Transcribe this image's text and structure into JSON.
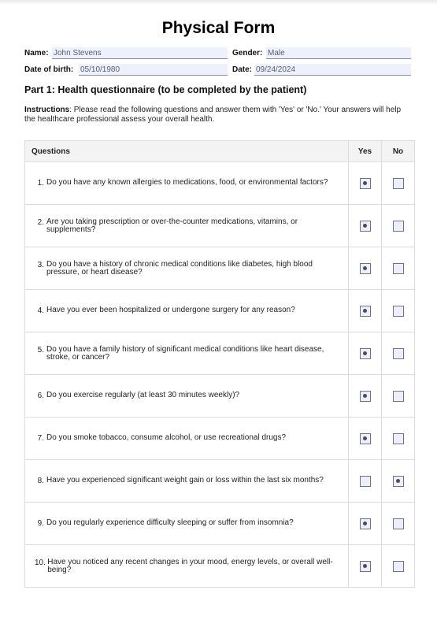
{
  "title": "Physical Form",
  "fields": {
    "name": {
      "label": "Name:",
      "value": "John Stevens"
    },
    "gender": {
      "label": "Gender:",
      "value": "Male"
    },
    "dob": {
      "label": "Date of birth:",
      "value": "05/10/1980"
    },
    "date": {
      "label": "Date:",
      "value": "09/24/2024"
    }
  },
  "part_title": "Part 1: Health questionnaire (to be completed by the patient)",
  "instructions": {
    "label": "Instructions",
    "text": ": Please read the following questions and answer them with 'Yes' or 'No.' Your answers will help the healthcare professional assess your overall health."
  },
  "table": {
    "headers": {
      "questions": "Questions",
      "yes": "Yes",
      "no": "No"
    },
    "rows": [
      {
        "num": "1.",
        "text": "Do you have any known allergies to medications, food, or environmental factors?",
        "answer": "yes"
      },
      {
        "num": "2.",
        "text": "Are you taking prescription or over-the-counter medications, vitamins, or supplements?",
        "answer": "yes"
      },
      {
        "num": "3.",
        "text": "Do you have a history of chronic medical conditions like diabetes, high blood pressure, or heart disease?",
        "answer": "yes"
      },
      {
        "num": "4.",
        "text": "Have you ever been hospitalized or undergone surgery for any reason?",
        "answer": "yes"
      },
      {
        "num": "5.",
        "text": "Do you have a family history of significant medical conditions like heart disease, stroke, or cancer?",
        "answer": "yes"
      },
      {
        "num": "6.",
        "text": "Do you exercise regularly (at least 30 minutes weekly)?",
        "answer": "yes"
      },
      {
        "num": "7.",
        "text": "Do you smoke tobacco, consume alcohol, or use recreational drugs?",
        "answer": "yes"
      },
      {
        "num": "8.",
        "text": "Have you experienced significant weight gain or loss within the last six months?",
        "answer": "no"
      },
      {
        "num": "9.",
        "text": "Do you regularly experience difficulty sleeping or suffer from insomnia?",
        "answer": "yes"
      },
      {
        "num": "10.",
        "text": "Have you noticed any recent changes in your mood, energy levels, or overall well-being?",
        "answer": "yes"
      }
    ]
  }
}
